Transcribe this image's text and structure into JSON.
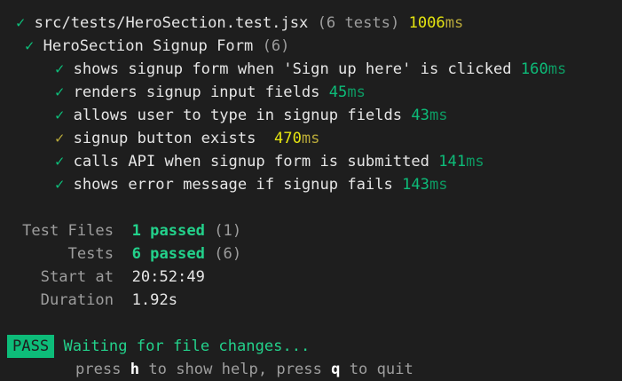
{
  "file": {
    "check": "✓",
    "path": "src/tests/HeroSection.test.jsx",
    "count": "(6 tests)",
    "duration": "1006",
    "unit": "ms"
  },
  "suite": {
    "check": "✓",
    "name": "HeroSection Signup Form",
    "count": "(6)"
  },
  "tests": [
    {
      "check": "✓",
      "name": "shows signup form when 'Sign up here' is clicked",
      "duration": "160",
      "unit": "ms",
      "slow": false
    },
    {
      "check": "✓",
      "name": "renders signup input fields",
      "duration": "45",
      "unit": "ms",
      "slow": false
    },
    {
      "check": "✓",
      "name": "allows user to type in signup fields",
      "duration": "43",
      "unit": "ms",
      "slow": false
    },
    {
      "check": "✓",
      "name": "signup button exists ",
      "duration": "470",
      "unit": "ms",
      "slow": true
    },
    {
      "check": "✓",
      "name": "calls API when signup form is submitted",
      "duration": "141",
      "unit": "ms",
      "slow": false
    },
    {
      "check": "✓",
      "name": "shows error message if signup fails",
      "duration": "143",
      "unit": "ms",
      "slow": false
    }
  ],
  "summary": {
    "test_files_label": "Test Files",
    "test_files_passed": "1 passed",
    "test_files_total": "(1)",
    "tests_label": "Tests",
    "tests_passed": "6 passed",
    "tests_total": "(6)",
    "start_label": "Start at",
    "start_value": "20:52:49",
    "duration_label": "Duration",
    "duration_value": "1.92s"
  },
  "status": {
    "badge": "PASS",
    "message": "Waiting for file changes..."
  },
  "hint": {
    "press1": "press ",
    "key_help": "h",
    "text_help": " to show help, press ",
    "key_quit": "q",
    "text_quit": " to quit"
  },
  "colors": {
    "background": "#1e1e1e",
    "pass_green": "#0dbc79",
    "slow_yellow": "#e5e510"
  }
}
